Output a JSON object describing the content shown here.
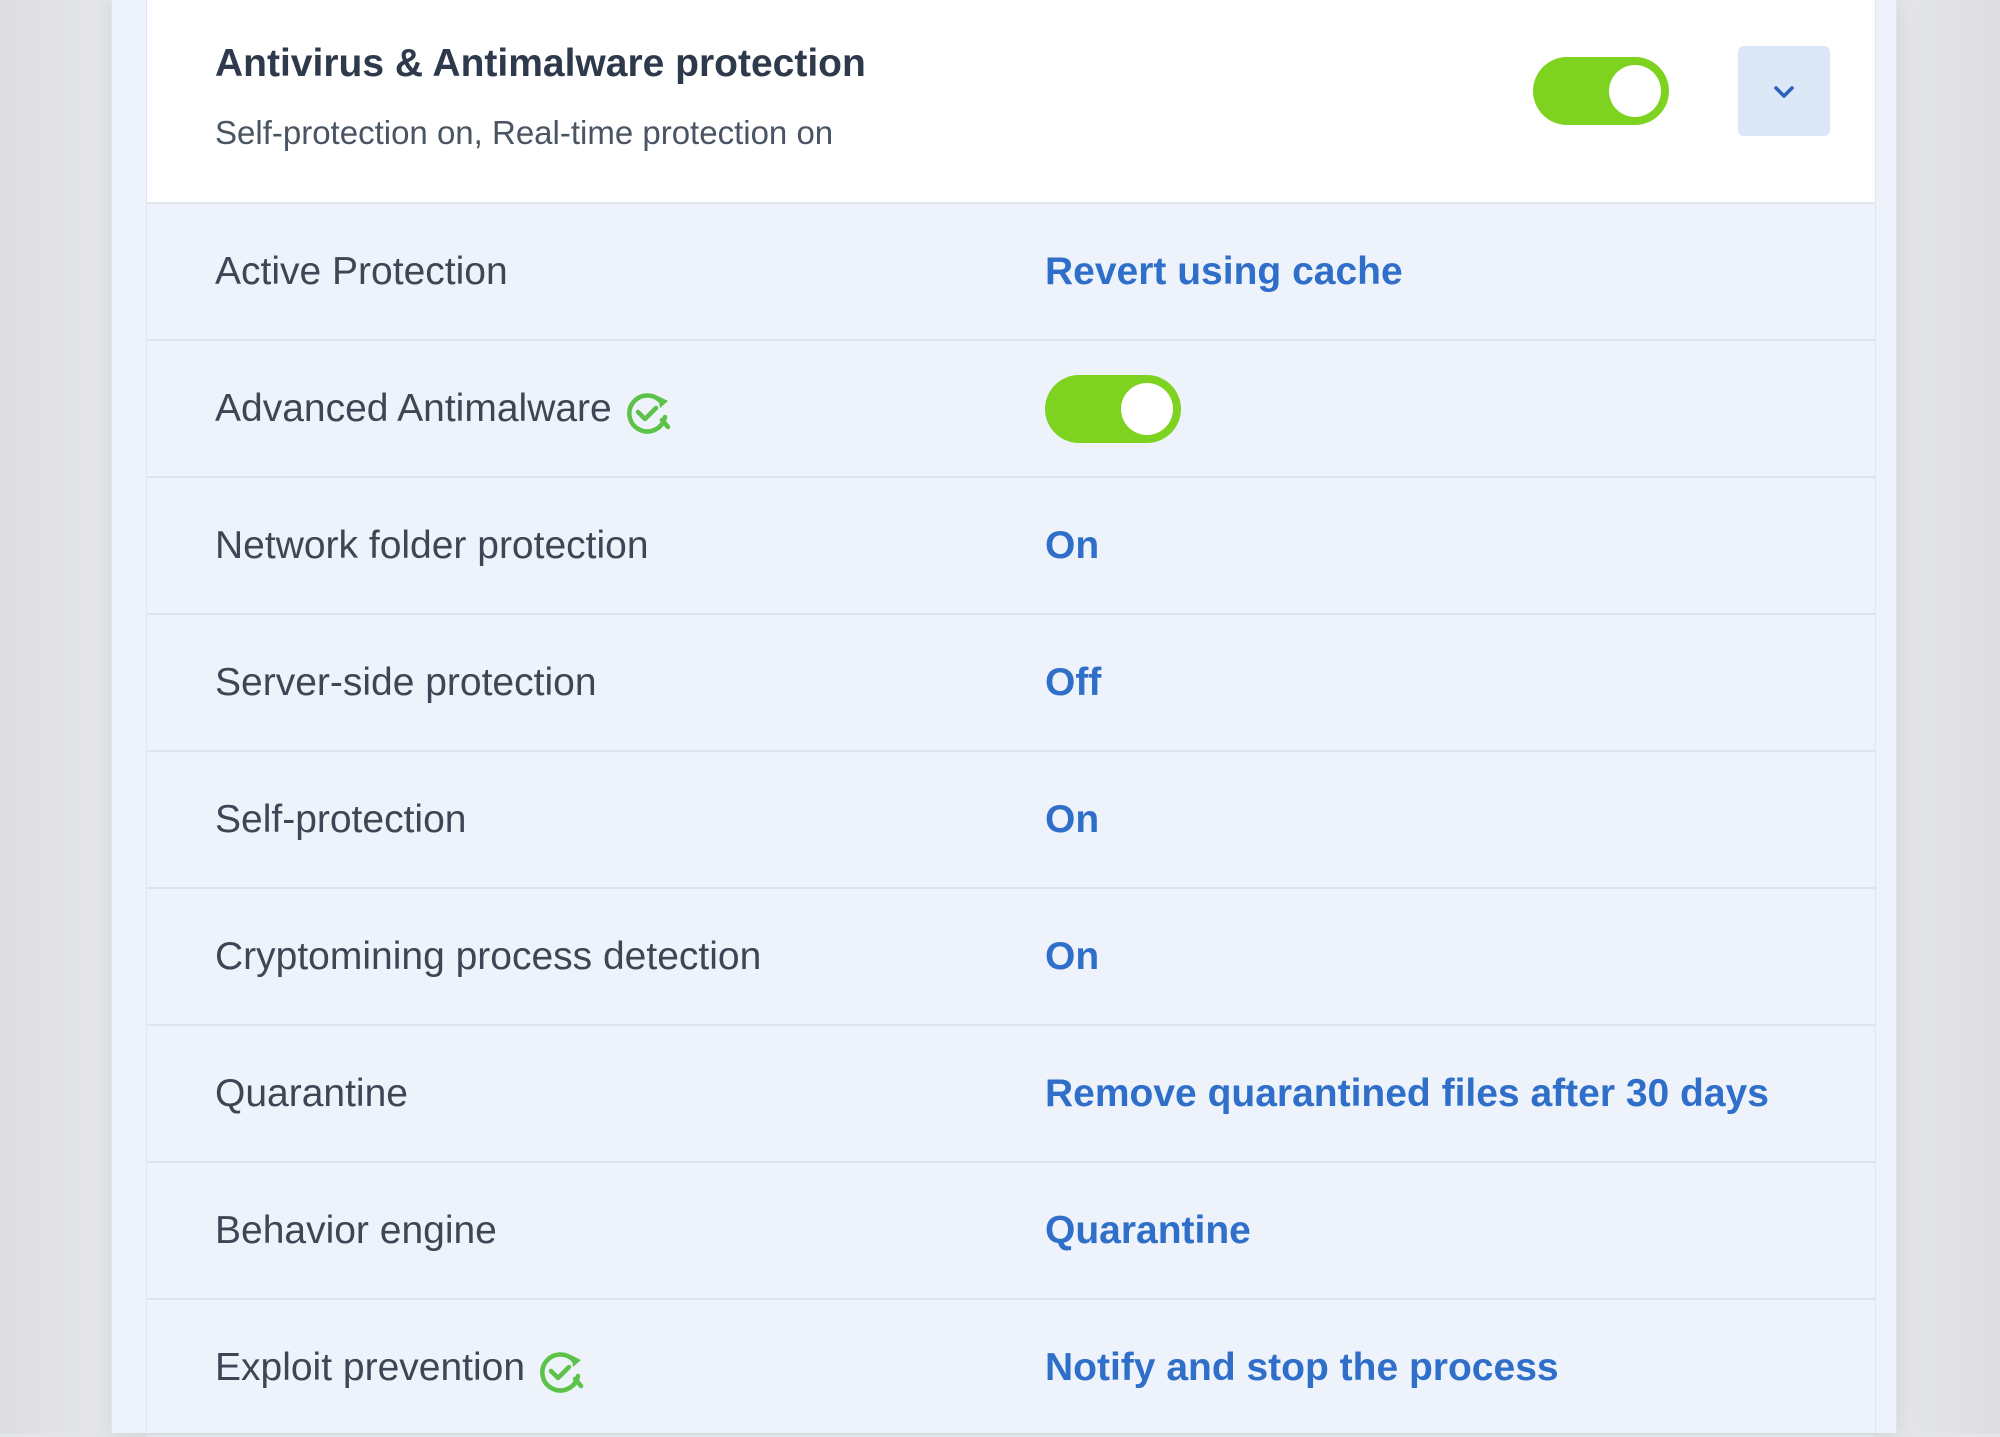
{
  "header": {
    "title": "Antivirus & Antimalware protection",
    "subtitle": "Self-protection on, Real-time protection on",
    "toggle_state": "on",
    "expand_icon": "chevron-down-icon"
  },
  "rows": [
    {
      "label": "Active Protection",
      "value": "Revert using cache",
      "type": "link"
    },
    {
      "label": "Advanced Antimalware",
      "value": "on",
      "type": "toggle",
      "badge_icon": "refresh-check-icon"
    },
    {
      "label": "Network folder protection",
      "value": "On",
      "type": "link"
    },
    {
      "label": "Server-side protection",
      "value": "Off",
      "type": "link"
    },
    {
      "label": "Self-protection",
      "value": "On",
      "type": "link"
    },
    {
      "label": "Cryptomining process detection",
      "value": "On",
      "type": "link"
    },
    {
      "label": "Quarantine",
      "value": "Remove quarantined files after 30 days",
      "type": "link"
    },
    {
      "label": "Behavior engine",
      "value": "Quarantine",
      "type": "link"
    },
    {
      "label": "Exploit prevention",
      "value": "Notify and stop the process",
      "type": "link",
      "badge_icon": "refresh-check-icon"
    }
  ],
  "colors": {
    "accent_link": "#2f6fc9",
    "toggle_on": "#7ed321",
    "badge_green": "#5cc24a",
    "header_bg": "#ffffff",
    "row_bg": "#eef3fb"
  }
}
